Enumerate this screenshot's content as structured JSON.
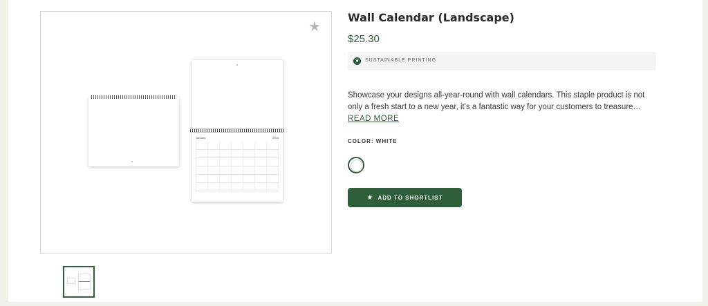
{
  "product": {
    "title": "Wall Calendar (Landscape)",
    "price": "$25.30",
    "badge_text": "SUSTAINABLE PRINTING",
    "badge_icon": "leaf-icon",
    "description": "Showcase your designs all-year-round with wall calendars. This staple product is not only a fresh start to a new year, it's a fantastic way for your customers to treasure…",
    "read_more_label": "READ MORE",
    "color_label": "COLOR: WHITE",
    "add_to_shortlist_label": "ADD TO SHORTLIST"
  },
  "gallery": {
    "favorite_icon": "star-icon",
    "calendar_month": "January",
    "calendar_year": "2024"
  },
  "colors": {
    "accent": "#2e5e3a",
    "background": "#f2f0eb"
  }
}
